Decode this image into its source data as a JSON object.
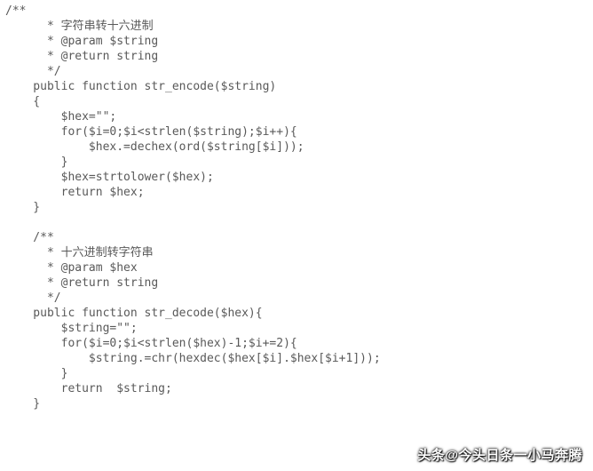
{
  "code": {
    "lines": [
      "/**",
      "      * 字符串转十六进制",
      "      * @param $string",
      "      * @return string",
      "      */",
      "    public function str_encode($string)",
      "    {",
      "        $hex=\"\";",
      "        for($i=0;$i<strlen($string);$i++){",
      "            $hex.=dechex(ord($string[$i]));",
      "        }",
      "        $hex=strtolower($hex);",
      "        return $hex;",
      "    }",
      "",
      "    /**",
      "      * 十六进制转字符串",
      "      * @param $hex",
      "      * @return string",
      "      */",
      "    public function str_decode($hex){",
      "        $string=\"\";",
      "        for($i=0;$i<strlen($hex)-1;$i+=2){",
      "            $string.=chr(hexdec($hex[$i].$hex[$i+1]));",
      "        }",
      "        return  $string;",
      "    }"
    ]
  },
  "watermark": {
    "text": "头条@今头日条一小马奔腾"
  }
}
